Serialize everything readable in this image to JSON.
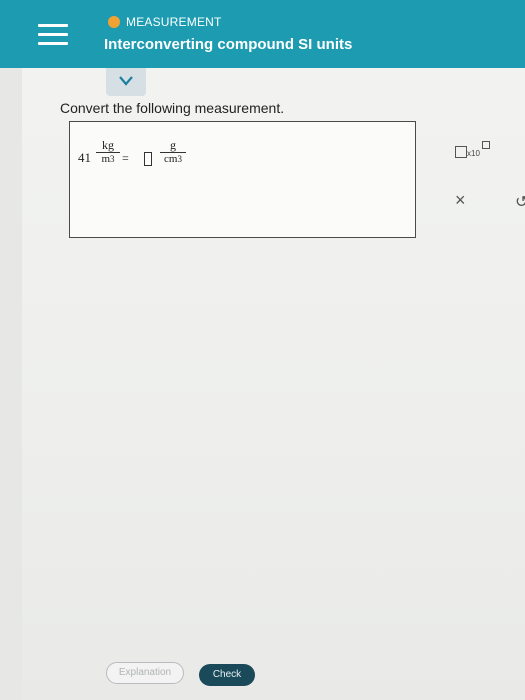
{
  "header": {
    "category": "MEASUREMENT",
    "title": "Interconverting compound SI units",
    "dot_color": "#f2a232",
    "bar_color": "#1d9cb1"
  },
  "question": {
    "prompt": "Convert the following measurement."
  },
  "expression": {
    "value": "41",
    "left_unit_num": "kg",
    "left_unit_den": "m",
    "left_den_exp": "3",
    "equals": "=",
    "right_unit_num": "g",
    "right_unit_den": "cm",
    "right_den_exp": "3"
  },
  "tools": {
    "sci_label": "x10",
    "close_symbol": "×",
    "undo_symbol": "↺"
  },
  "footer": {
    "explanation_label": "Explanation",
    "check_label": "Check"
  }
}
